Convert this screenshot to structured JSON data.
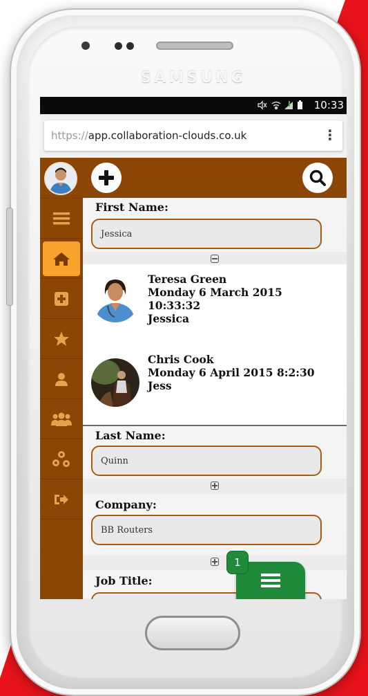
{
  "device": {
    "brand": "SAMSUNG"
  },
  "status_bar": {
    "time": "10:33",
    "icons": [
      "mute-icon",
      "wifi-icon",
      "signal-icon",
      "battery-icon"
    ]
  },
  "browser": {
    "url_scheme": "https://",
    "url_host": "app.collaboration-clouds.co.uk",
    "menu_icon": "more-vert-icon"
  },
  "sidebar": {
    "items": [
      {
        "name": "menu",
        "icon": "hamburger-icon",
        "active": false
      },
      {
        "name": "home",
        "icon": "home-icon",
        "active": true
      },
      {
        "name": "add",
        "icon": "plus-square-icon",
        "active": false
      },
      {
        "name": "favourites",
        "icon": "star-icon",
        "active": false
      },
      {
        "name": "contact",
        "icon": "user-icon",
        "active": false
      },
      {
        "name": "group",
        "icon": "users-icon",
        "active": false
      },
      {
        "name": "network",
        "icon": "sitemap-icon",
        "active": false
      },
      {
        "name": "logout",
        "icon": "sign-out-icon",
        "active": false
      }
    ]
  },
  "toolbar": {
    "add_icon": "plus-circle-icon",
    "search_icon": "search-icon"
  },
  "form": {
    "first_name": {
      "label": "First Name:",
      "value": "Jessica"
    },
    "last_name": {
      "label": "Last Name:",
      "value": "Quinn"
    },
    "company": {
      "label": "Company:",
      "value": "BB Routers"
    },
    "job_title": {
      "label": "Job Title:",
      "value": ""
    }
  },
  "history": [
    {
      "name": "Teresa Green",
      "date": "Monday 6 March 2015",
      "time": "10:33:32",
      "value": "Jessica"
    },
    {
      "name": "Chris Cook",
      "date_time": "Monday 6 April 2015 8:2:30",
      "value": "Jess"
    }
  ],
  "fab": {
    "badge": "1",
    "icon": "list-icon"
  },
  "colors": {
    "brand_brown": "#8b4505",
    "accent_orange": "#f8a32b",
    "fab_green": "#1f8a3a",
    "input_border": "#a55b12",
    "red_stripe": "#e8141b"
  }
}
